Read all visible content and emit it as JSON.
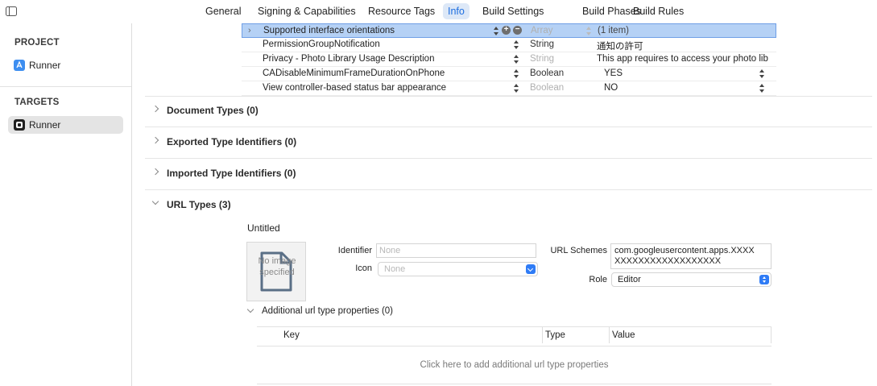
{
  "tabs": [
    {
      "label": "General",
      "active": false
    },
    {
      "label": "Signing & Capabilities",
      "active": false
    },
    {
      "label": "Resource Tags",
      "active": false
    },
    {
      "label": "Info",
      "active": true
    },
    {
      "label": "Build Settings",
      "active": false
    },
    {
      "label": "Build Phases",
      "active": false
    },
    {
      "label": "Build Rules",
      "active": false
    }
  ],
  "sidebar": {
    "project_header": "PROJECT",
    "project_item": "Runner",
    "targets_header": "TARGETS",
    "target_item": "Runner"
  },
  "plist": [
    {
      "key": "Supported interface orientations",
      "type": "Array",
      "value": "(1 item)"
    },
    {
      "key": "PermissionGroupNotification",
      "type": "String",
      "value": "通知の許可"
    },
    {
      "key": "Privacy - Photo Library Usage Description",
      "type": "String",
      "value": "This app requires to access your photo lib"
    },
    {
      "key": "CADisableMinimumFrameDurationOnPhone",
      "type": "Boolean",
      "value": "YES"
    },
    {
      "key": "View controller-based status bar appearance",
      "type": "Boolean",
      "value": "NO"
    }
  ],
  "sections": {
    "document_types": "Document Types (0)",
    "exported": "Exported Type Identifiers (0)",
    "imported": "Imported Type Identifiers (0)",
    "url_types": "URL Types (3)"
  },
  "url_type": {
    "name": "Untitled",
    "no_image": "No image specified",
    "identifier_label": "Identifier",
    "identifier_placeholder": "None",
    "icon_label": "Icon",
    "icon_placeholder": "None",
    "url_schemes_label": "URL Schemes",
    "url_schemes_line1": "com.googleusercontent.apps.XXXX",
    "url_schemes_line2": "XXXXXXXXXXXXXXXXXX",
    "role_label": "Role",
    "role_value": "Editor",
    "additional_title": "Additional url type properties (0)",
    "columns": [
      "Key",
      "Type",
      "Value"
    ],
    "add_hint": "Click here to add additional url type properties"
  },
  "colors": {
    "accent": "#2f7cf6",
    "selection": "#b5d1f5",
    "active_tab_bg": "#dde8f7"
  }
}
